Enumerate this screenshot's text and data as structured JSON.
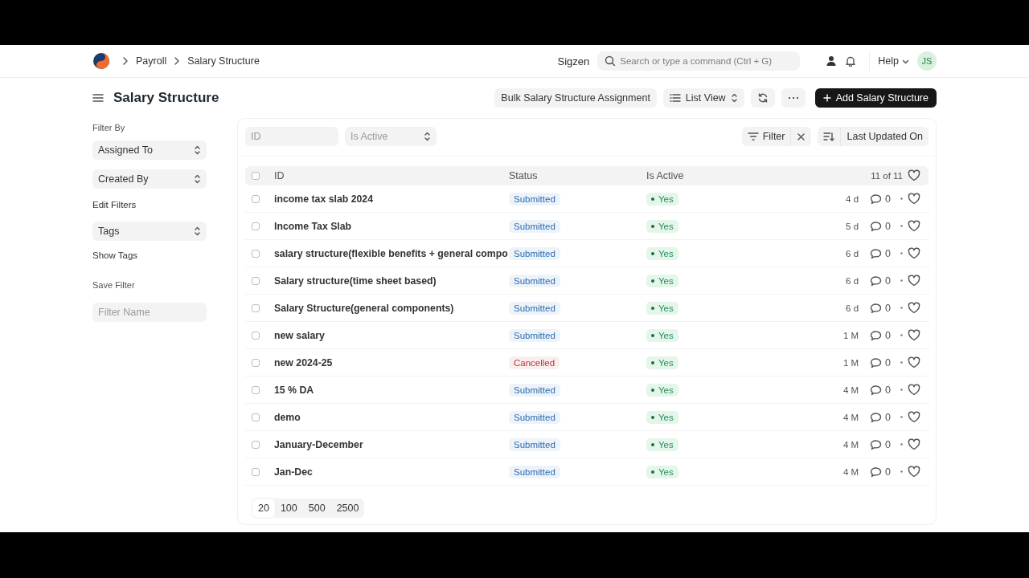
{
  "navbar": {
    "breadcrumbs": [
      "Payroll",
      "Salary Structure"
    ],
    "company": "Sigzen",
    "search": {
      "placeholder": "Search or type a command (Ctrl + G)"
    },
    "help": "Help",
    "avatar": "JS"
  },
  "page": {
    "title": "Salary Structure",
    "actions": [
      {
        "kind": "text",
        "label": "Bulk Salary Structure Assignment"
      },
      {
        "kind": "select",
        "label": "List View"
      },
      {
        "kind": "refresh"
      },
      {
        "kind": "more"
      },
      {
        "kind": "primary",
        "label": "Add Salary Structure"
      }
    ]
  },
  "sidebar": {
    "filter_heading": "Filter By",
    "group_by": [
      "Assigned To",
      "Created By"
    ],
    "edit_filters": "Edit Filters",
    "tags": "Tags",
    "show_tags": "Show Tags",
    "save_heading": "Save Filter",
    "filter_name": {
      "placeholder": "Filter Name"
    }
  },
  "filters": {
    "id": {
      "placeholder": "ID"
    },
    "is_active": {
      "placeholder": "Is Active"
    },
    "filter": "Filter",
    "sort": "Last Updated On"
  },
  "table": {
    "all_checked": false,
    "columns": [
      "ID",
      "Status",
      "Is Active"
    ],
    "count": "11 of 11",
    "rows": [
      {
        "checked": false,
        "id": "income tax slab 2024",
        "status": {
          "label": "Submitted",
          "color": "#2b6cb0"
        },
        "is_active": "Yes",
        "modified": "4 d",
        "comments": "0"
      },
      {
        "checked": false,
        "id": "Income Tax Slab",
        "status": {
          "label": "Submitted",
          "color": "#2b6cb0"
        },
        "is_active": "Yes",
        "modified": "5 d",
        "comments": "0"
      },
      {
        "checked": false,
        "id": "salary structure(flexible benefits + general compo",
        "status": {
          "label": "Submitted",
          "color": "#2b6cb0"
        },
        "is_active": "Yes",
        "modified": "6 d",
        "comments": "0"
      },
      {
        "checked": false,
        "id": "Salary structure(time sheet based)",
        "status": {
          "label": "Submitted",
          "color": "#2b6cb0"
        },
        "is_active": "Yes",
        "modified": "6 d",
        "comments": "0"
      },
      {
        "checked": false,
        "id": "Salary Structure(general components)",
        "status": {
          "label": "Submitted",
          "color": "#2b6cb0"
        },
        "is_active": "Yes",
        "modified": "6 d",
        "comments": "0"
      },
      {
        "checked": false,
        "id": "new salary",
        "status": {
          "label": "Submitted",
          "color": "#2b6cb0"
        },
        "is_active": "Yes",
        "modified": "1 M",
        "comments": "0"
      },
      {
        "checked": false,
        "id": "new 2024-25",
        "status": {
          "label": "Cancelled",
          "color": "#c53030"
        },
        "is_active": "Yes",
        "modified": "1 M",
        "comments": "0"
      },
      {
        "checked": false,
        "id": "15 % DA",
        "status": {
          "label": "Submitted",
          "color": "#2b6cb0"
        },
        "is_active": "Yes",
        "modified": "4 M",
        "comments": "0"
      },
      {
        "checked": false,
        "id": "demo",
        "status": {
          "label": "Submitted",
          "color": "#2b6cb0"
        },
        "is_active": "Yes",
        "modified": "4 M",
        "comments": "0"
      },
      {
        "checked": false,
        "id": "January-December",
        "status": {
          "label": "Submitted",
          "color": "#2b6cb0"
        },
        "is_active": "Yes",
        "modified": "4 M",
        "comments": "0"
      },
      {
        "checked": false,
        "id": "Jan-Dec",
        "status": {
          "label": "Submitted",
          "color": "#2b6cb0"
        },
        "is_active": "Yes",
        "modified": "4 M",
        "comments": "0"
      }
    ]
  },
  "page_sizes": [
    {
      "label": "20",
      "selected": true
    },
    {
      "label": "100",
      "selected": false
    },
    {
      "label": "500",
      "selected": false
    },
    {
      "label": "2500",
      "selected": false
    }
  ]
}
